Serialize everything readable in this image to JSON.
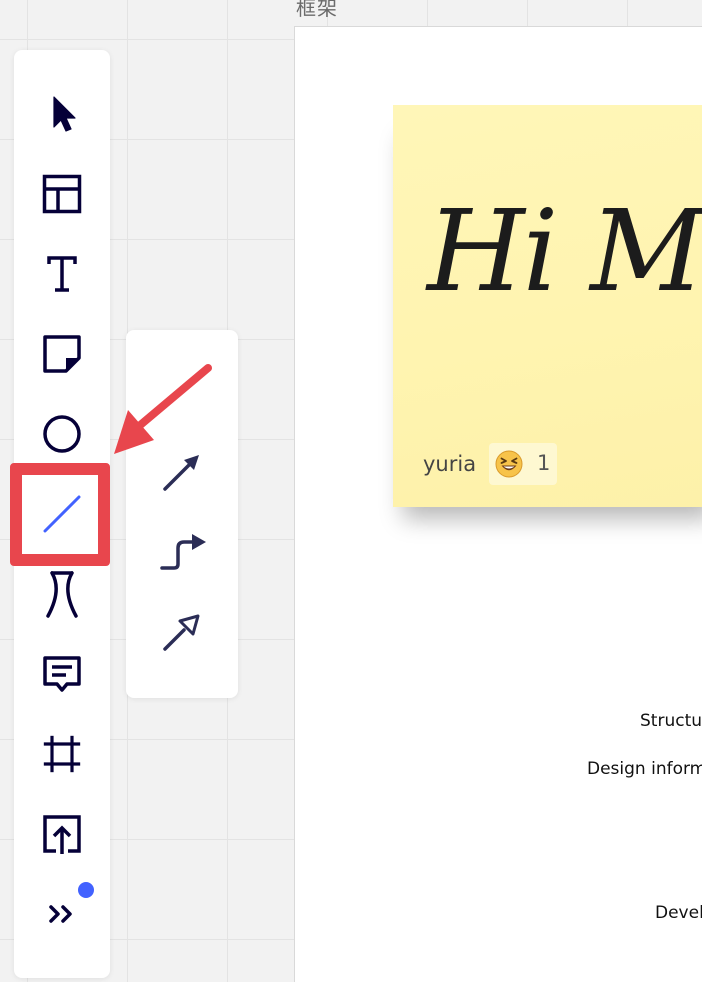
{
  "canvas": {
    "frame_title": "框架",
    "sticky_note": {
      "text": "Hi Mir",
      "author": "yuria",
      "reaction": {
        "emoji": "grinning-squinting-face",
        "count": "1"
      }
    },
    "frame_texts": [
      "Structu",
      "Design inform",
      "Devel"
    ]
  },
  "toolbar": {
    "tools": [
      {
        "name": "select",
        "icon": "cursor-arrow-icon"
      },
      {
        "name": "templates",
        "icon": "layout-template-icon"
      },
      {
        "name": "text",
        "icon": "text-t-icon"
      },
      {
        "name": "sticky-note",
        "icon": "sticky-note-icon"
      },
      {
        "name": "shapes",
        "icon": "circle-icon"
      },
      {
        "name": "line",
        "icon": "diagonal-line-icon",
        "active": true
      },
      {
        "name": "pen",
        "icon": "pen-icon"
      },
      {
        "name": "comment",
        "icon": "comment-icon"
      },
      {
        "name": "frame",
        "icon": "frame-grid-icon"
      },
      {
        "name": "upload",
        "icon": "upload-icon"
      },
      {
        "name": "more",
        "icon": "double-chevron-right-icon"
      }
    ],
    "notification_dot_color": "#4262ff"
  },
  "line_submenu": {
    "items": [
      {
        "name": "straight-arrow",
        "icon": "straight-arrow-icon"
      },
      {
        "name": "elbow-arrow",
        "icon": "elbow-arrow-icon"
      },
      {
        "name": "outline-arrow",
        "icon": "outline-arrow-icon"
      }
    ]
  },
  "annotation": {
    "color": "#e8464d"
  }
}
